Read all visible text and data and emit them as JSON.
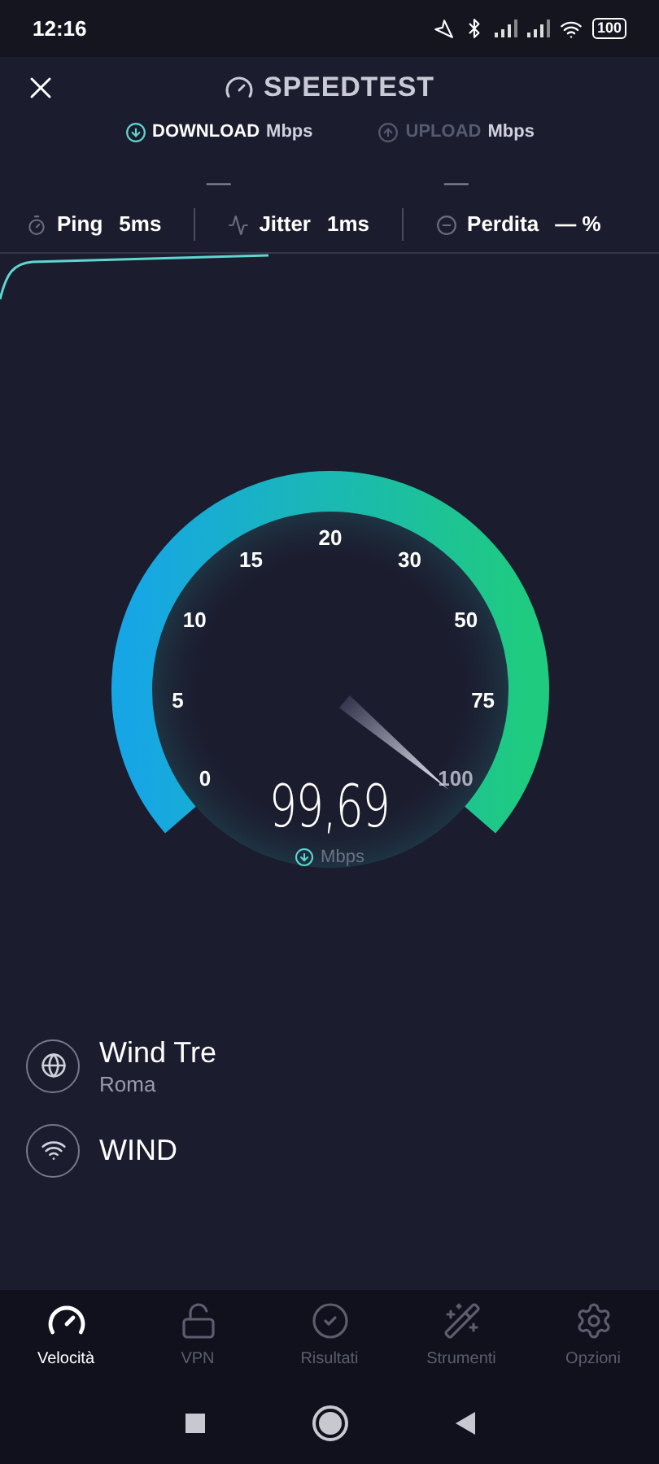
{
  "status_bar": {
    "time": "12:16",
    "battery": "100"
  },
  "header": {
    "title": "SPEEDTEST"
  },
  "tabs": [
    {
      "label": "DOWNLOAD",
      "unit": "Mbps",
      "value": "—",
      "selected": true
    },
    {
      "label": "UPLOAD",
      "unit": "Mbps",
      "value": "—",
      "selected": false
    }
  ],
  "stats": [
    {
      "kind": "ping",
      "label": "Ping",
      "value": "5ms"
    },
    {
      "kind": "jitter",
      "label": "Jitter",
      "value": "1ms"
    },
    {
      "kind": "loss",
      "label": "Perdita",
      "value": "— %"
    }
  ],
  "gauge": {
    "ticks": [
      "0",
      "5",
      "10",
      "15",
      "20",
      "30",
      "50",
      "75",
      "100"
    ],
    "reading": "99,69",
    "unit": "Mbps"
  },
  "connection": [
    {
      "kind": "globe",
      "name": "Wind Tre",
      "detail": "Roma"
    },
    {
      "kind": "wifi",
      "name": "WIND"
    }
  ],
  "nav": [
    {
      "kind": "speed",
      "label": "Velocità",
      "selected": true
    },
    {
      "kind": "vpn",
      "label": "VPN",
      "selected": false
    },
    {
      "kind": "results",
      "label": "Risultati",
      "selected": false
    },
    {
      "kind": "tools",
      "label": "Strumenti",
      "selected": false
    },
    {
      "kind": "options",
      "label": "Opzioni",
      "selected": false
    }
  ]
}
